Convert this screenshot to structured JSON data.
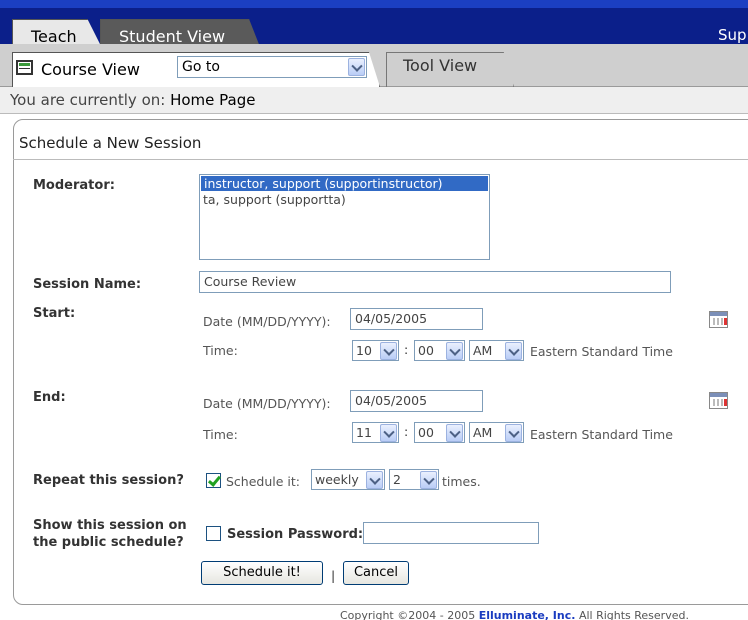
{
  "tabs": {
    "teach": "Teach",
    "student_view": "Student View",
    "support_cut": "Sup"
  },
  "course_bar": {
    "course_view": "Course View",
    "goto": "Go to",
    "tool_view": "Tool View"
  },
  "breadcrumb": {
    "prefix": "You are currently on:",
    "page": "Home Page"
  },
  "panel": {
    "title": "Schedule a New Session"
  },
  "form": {
    "moderator_label": "Moderator:",
    "moderators": [
      "instructor, support (supportinstructor)",
      "ta, support (supportta)"
    ],
    "session_name_label": "Session Name:",
    "session_name": "Course Review",
    "start_label": "Start:",
    "end_label": "End:",
    "date_label": "Date (MM/DD/YYYY):",
    "time_label": "Time:",
    "colon": ":",
    "timezone": "Eastern Standard Time",
    "start": {
      "date": "04/05/2005",
      "hour": "10",
      "minute": "00",
      "ampm": "AM"
    },
    "end": {
      "date": "04/05/2005",
      "hour": "11",
      "minute": "00",
      "ampm": "AM"
    },
    "repeat_label": "Repeat this session?",
    "schedule_it_label": "Schedule it:",
    "repeat_frequency": "weekly",
    "repeat_count": "2",
    "times_label": "times.",
    "public_label_line1": "Show this session on",
    "public_label_line2": "the public schedule?",
    "password_label": "Session Password:",
    "password_value": "",
    "schedule_button": "Schedule it!",
    "separator": "|",
    "cancel_button": "Cancel"
  },
  "footer": {
    "prefix": "Copyright ©2004 - 2005",
    "company": "Elluminate, Inc.",
    "suffix": "All Rights Reserved."
  }
}
